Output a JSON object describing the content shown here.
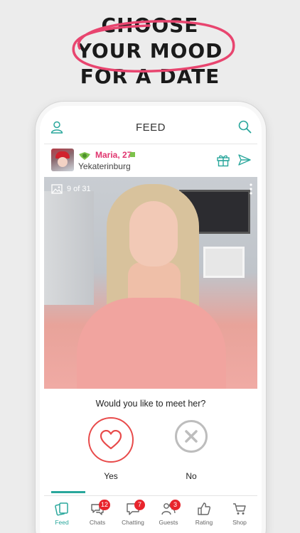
{
  "promo": {
    "lines": [
      "CHOOSE",
      "YOUR MOOD",
      "FOR A DATE"
    ],
    "accent_color": "#e8456f"
  },
  "header": {
    "title": "FEED",
    "profile_icon": "person-icon",
    "search_icon": "search-icon",
    "accent_color": "#2aa79c"
  },
  "user": {
    "name": "Maria, 27",
    "city": "Yekaterinburg",
    "badge_icon": "green-wings-icon",
    "online_status": "online",
    "actions": [
      "gift-icon",
      "send-icon"
    ]
  },
  "photo": {
    "counter": "9 of 31",
    "gallery_icon": "image-icon",
    "more_icon": "vertical-dots-icon"
  },
  "meet": {
    "question": "Would you like to meet her?",
    "yes_label": "Yes",
    "no_label": "No",
    "yes_color": "#e84b4b",
    "no_color": "#bdbdbd"
  },
  "tabs": [
    {
      "label": "Feed",
      "icon": "feed-cards-icon",
      "count": "",
      "active": true
    },
    {
      "label": "Chats",
      "icon": "chat-bubbles-icon",
      "count": "12",
      "active": false
    },
    {
      "label": "Chatting",
      "icon": "chat-bubble-icon",
      "count": "7",
      "active": false
    },
    {
      "label": "Guests",
      "icon": "guests-icon",
      "count": "3",
      "active": false
    },
    {
      "label": "Rating",
      "icon": "thumbs-up-icon",
      "count": "",
      "active": false
    },
    {
      "label": "Shop",
      "icon": "cart-icon",
      "count": "",
      "active": false
    }
  ]
}
